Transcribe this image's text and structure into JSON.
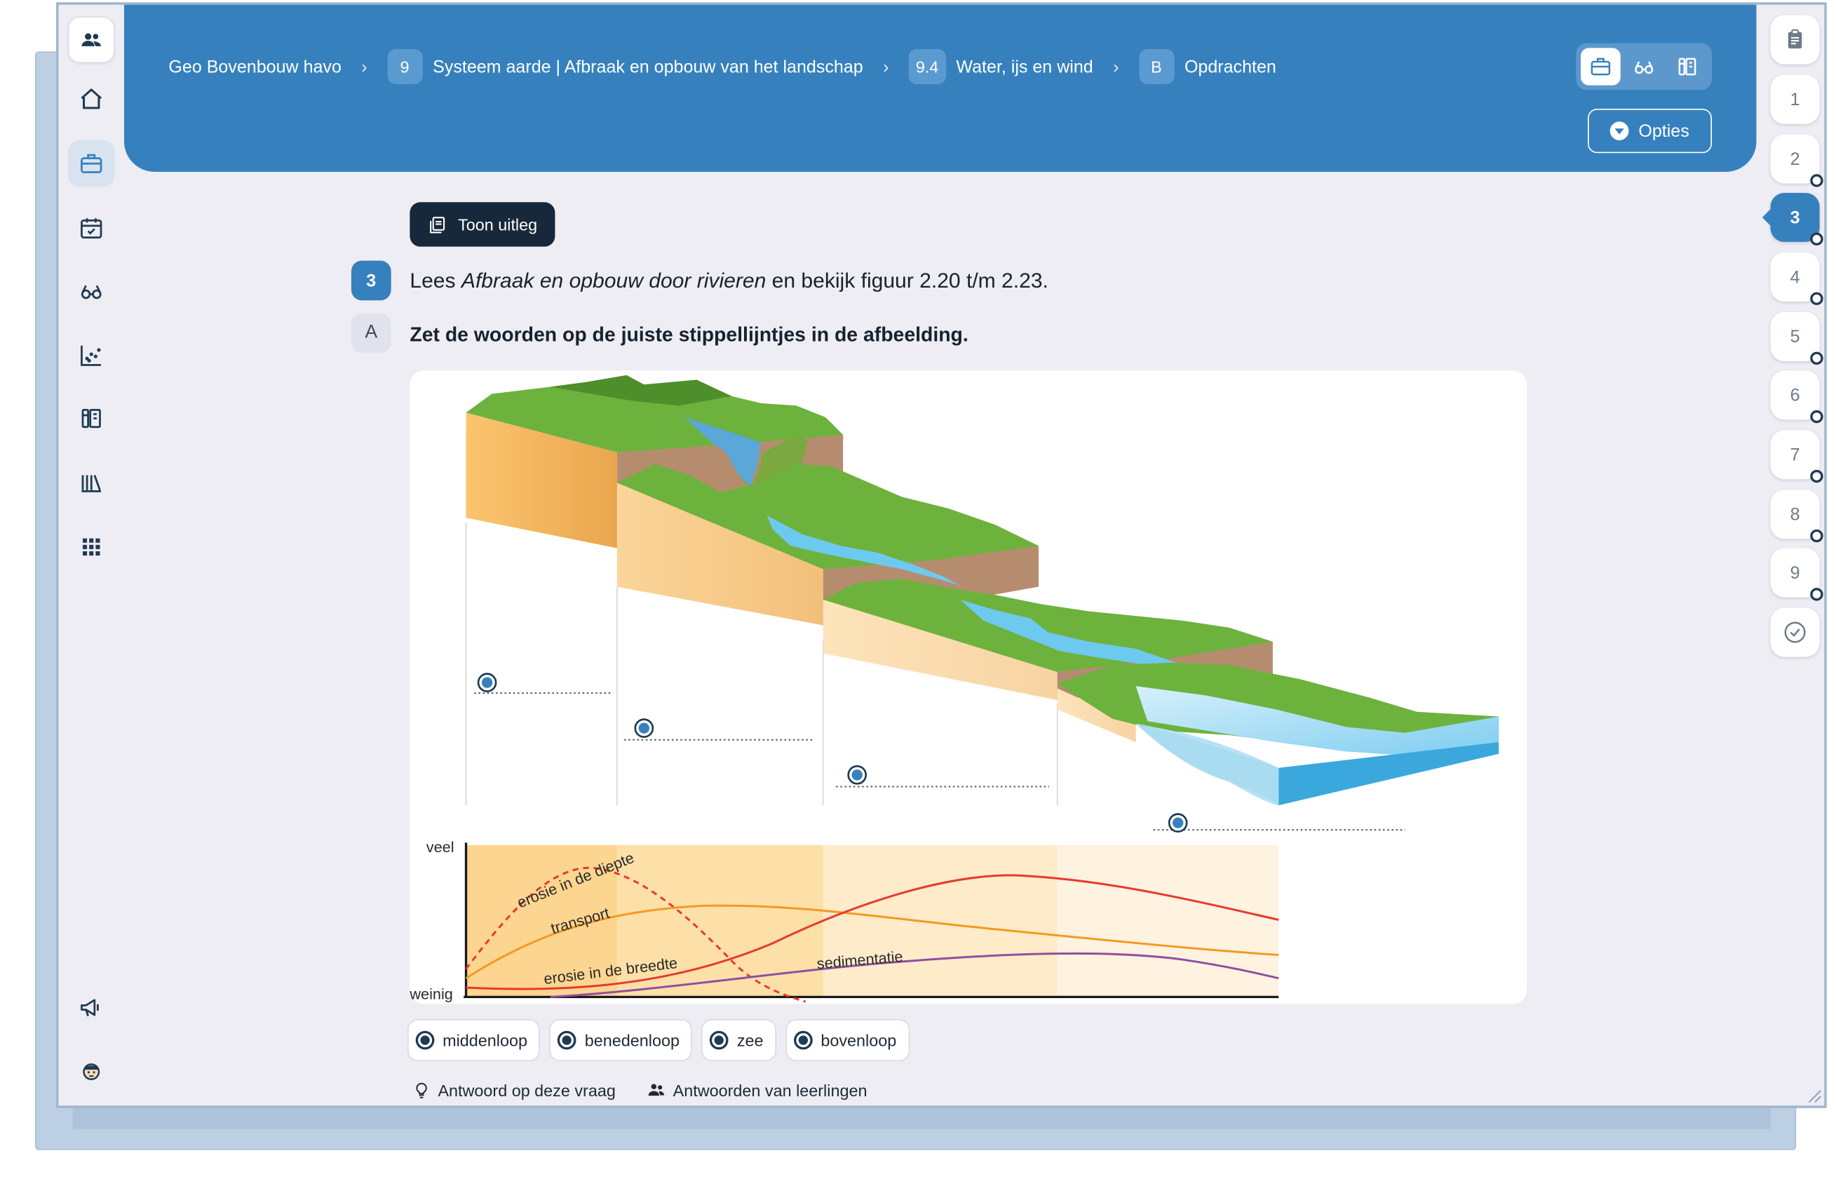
{
  "breadcrumb": {
    "course": "Geo Bovenbouw havo",
    "chapter_num": "9",
    "chapter": "Systeem aarde | Afbraak en opbouw van het landschap",
    "section_num": "9.4",
    "section": "Water, ijs en wind",
    "part_num": "B",
    "part": "Opdrachten",
    "separator": "›"
  },
  "header": {
    "options_label": "Opties"
  },
  "sidebar": {
    "items": [
      "avatar-group-icon",
      "home-icon",
      "briefcase-icon",
      "calendar-check-icon",
      "glasses-icon",
      "chart-icon",
      "book-stack-icon",
      "library-icon",
      "grid-icon",
      "megaphone-icon",
      "student-avatar-icon"
    ],
    "active": "briefcase-icon"
  },
  "view_toggle": [
    "briefcase-icon",
    "glasses-icon",
    "book-stack-icon"
  ],
  "question_nav": {
    "items": [
      "1",
      "2",
      "3",
      "4",
      "5",
      "6",
      "7",
      "8",
      "9"
    ],
    "active": "3"
  },
  "content": {
    "show_explanation": "Toon uitleg",
    "question_number": "3",
    "question_prefix": "Lees ",
    "question_italic": "Afbraak en opbouw door rivieren",
    "question_suffix": " en bekijk figuur 2.20 t/m 2.23.",
    "sub_label": "A",
    "instruction": "Zet de woorden op de juiste stippellijntjes in de afbeelding."
  },
  "figure": {
    "y_high": "veel",
    "y_low": "weinig",
    "curves": {
      "erosion_depth": "erosie in de diepte",
      "transport": "transport",
      "erosion_width": "erosie in de breedte",
      "sedimentation": "sedimentatie"
    },
    "colors": {
      "erosion": "#e63a2e",
      "transport": "#f29a23",
      "sedimentation": "#8e4fa0",
      "water": "#4db7e3",
      "grass": "#6fb23c"
    }
  },
  "answer_chips": [
    "middenloop",
    "benedenloop",
    "zee",
    "bovenloop"
  ],
  "links": {
    "answer": "Antwoord op deze vraag",
    "student_answers": "Antwoorden van leerlingen"
  },
  "accent_color": "#3681bd"
}
